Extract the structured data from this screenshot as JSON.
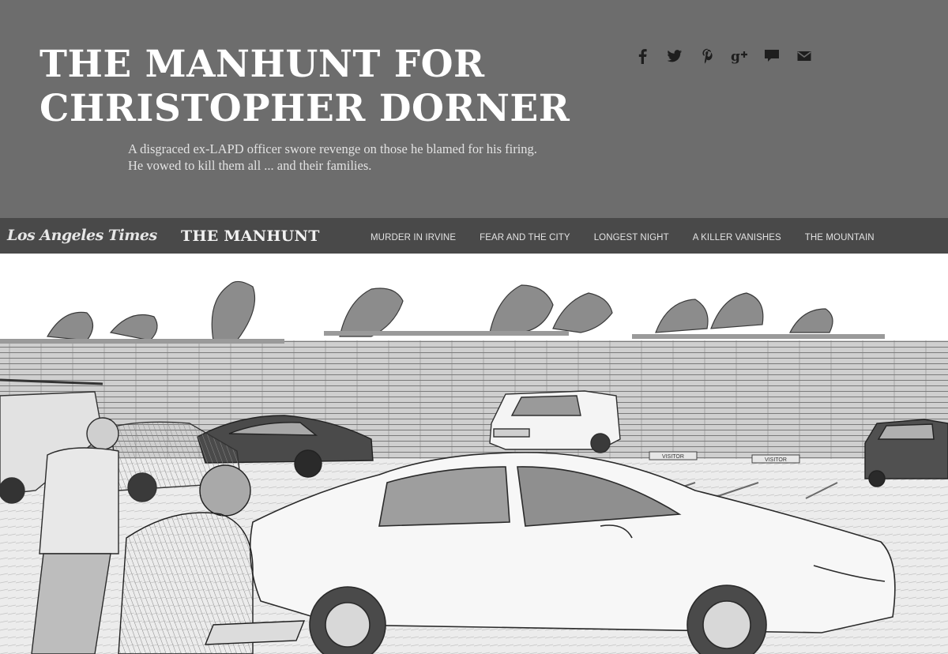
{
  "header": {
    "title_line_1": "THE MANHUNT FOR",
    "title_line_2": "CHRISTOPHER DORNER",
    "dek": "A disgraced ex-LAPD officer swore revenge on those he blamed for his firing. He vowed to kill them all ... and their families.",
    "share_icons": [
      "facebook-icon",
      "twitter-icon",
      "pinterest-icon",
      "google-plus-icon",
      "comment-icon",
      "email-icon"
    ]
  },
  "nav": {
    "logo": "Los Angeles Times",
    "section_title": "THE MANHUNT",
    "links": [
      "MURDER IN IRVINE",
      "FEAR AND THE CITY",
      "LONGEST NIGHT",
      "A KILLER VANISHES",
      "THE MOUNTAIN"
    ]
  },
  "hero": {
    "parking_sign_1": "VISITOR",
    "parking_sign_2": "VISITOR"
  },
  "colors": {
    "header_bg": "#6d6d6d",
    "nav_bg": "#494949",
    "title_text": "#ffffff",
    "dek_text": "#e2e2e2"
  }
}
